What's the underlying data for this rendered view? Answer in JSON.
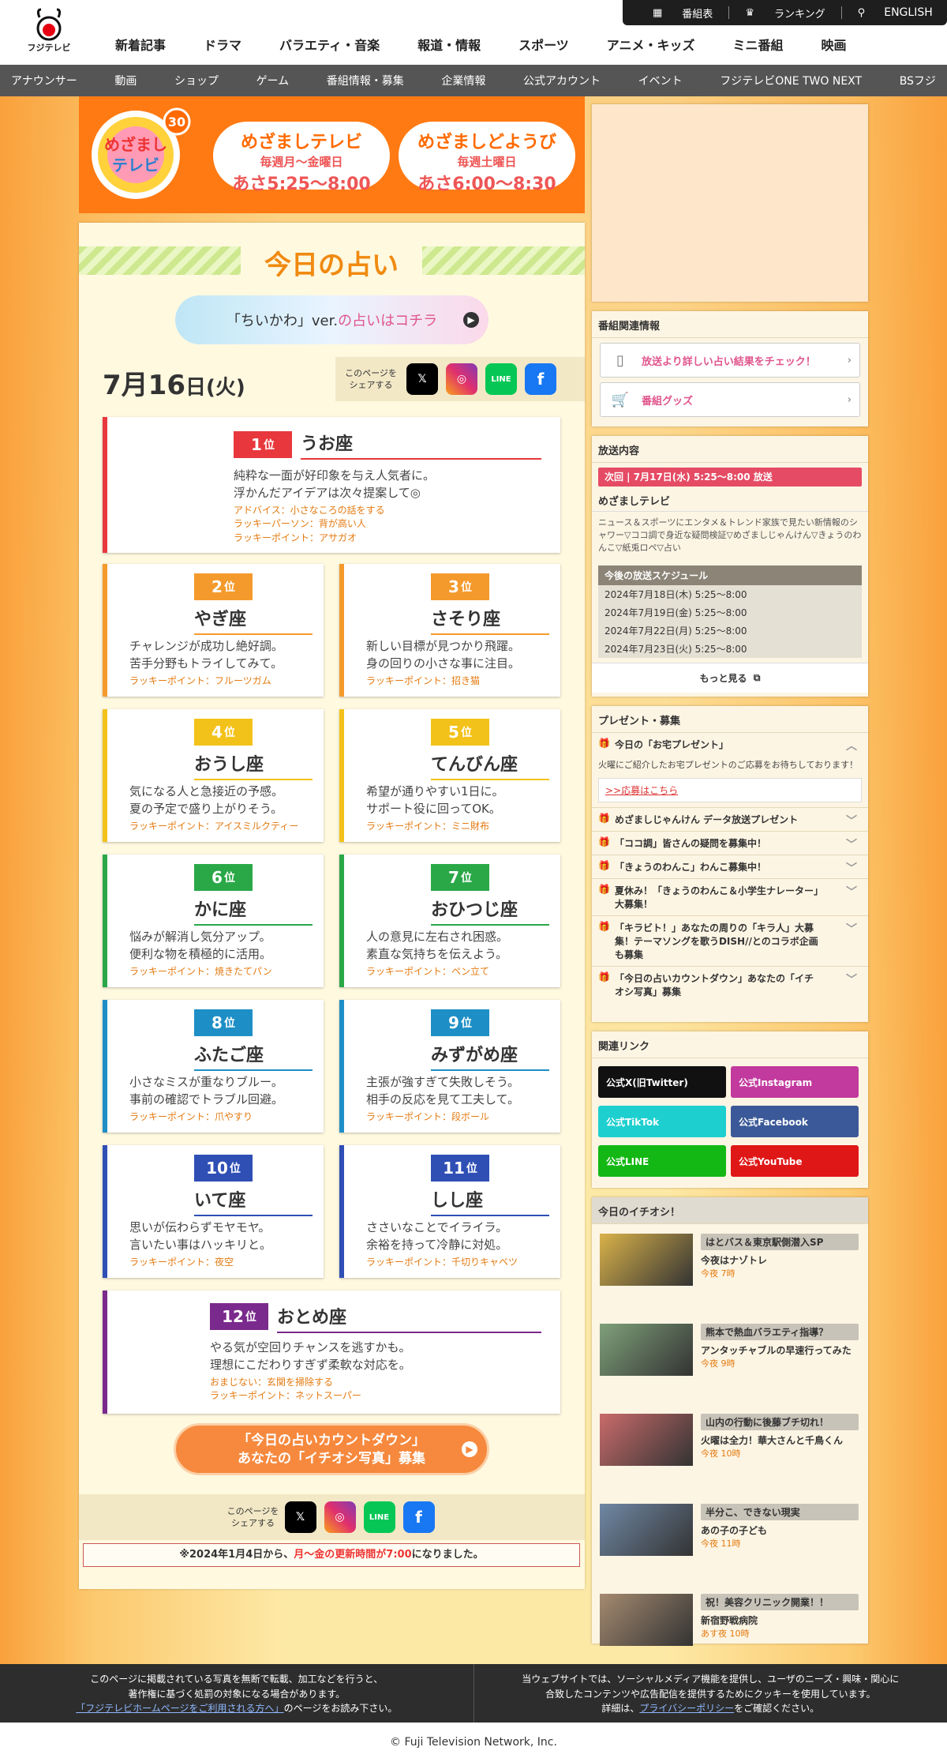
{
  "header": {
    "logo_text": "フジテレビ",
    "util": [
      "番組表",
      "ランキング",
      "検索"
    ],
    "english": "ENGLISH",
    "nav": [
      "新着記事",
      "ドラマ",
      "バラエティ・音楽",
      "報道・情報",
      "スポーツ",
      "アニメ・キッズ",
      "ミニ番組",
      "映画"
    ],
    "subnav": [
      "アナウンサー",
      "動画",
      "ショップ",
      "ゲーム",
      "番組情報・募集",
      "企業情報",
      "公式アカウント",
      "イベント",
      "フジテレビONE TWO NEXT",
      "BSフジ"
    ]
  },
  "banner": {
    "logo": "めざましテレビ 30",
    "p1": {
      "t1": "めざましテレビ",
      "t2": "毎週月〜金曜日",
      "t3": "あさ5:25〜8:00"
    },
    "p2": {
      "t1": "めざましどようび",
      "t2": "毎週土曜日",
      "t3": "あさ6:00〜8:30"
    }
  },
  "uranai": {
    "title": "今日の占い",
    "chiikawa_a": "「ちいかわ」ver.",
    "chiikawa_b": "の占いはコチラ",
    "date_num": "7月16",
    "date_d": "日",
    "date_w": "(火)",
    "share_label": "このページを\nシェアする",
    "cards": [
      {
        "rank": "1",
        "suffix": "位",
        "name": "うお座",
        "l1": "純粋な一面が好印象を与え人気者に。",
        "l2": "浮かんだアイデアは次々提案して◎",
        "x": [
          "アドバイス：小さなころの話をする",
          "ラッキーパーソン：背が高い人",
          "ラッキーポイント：アサガオ"
        ],
        "color": "#e8383d"
      },
      {
        "rank": "2",
        "suffix": "位",
        "name": "やぎ座",
        "l1": "チャレンジが成功し絶好調。",
        "l2": "苦手分野もトライしてみて。",
        "x": [
          "ラッキーポイント：フルーツガム"
        ],
        "color": "#f49a2c"
      },
      {
        "rank": "3",
        "suffix": "位",
        "name": "さそり座",
        "l1": "新しい目標が見つかり飛躍。",
        "l2": "身の回りの小さな事に注目。",
        "x": [
          "ラッキーポイント：招き猫"
        ],
        "color": "#f49a2c"
      },
      {
        "rank": "4",
        "suffix": "位",
        "name": "おうし座",
        "l1": "気になる人と急接近の予感。",
        "l2": "夏の予定で盛り上がりそう。",
        "x": [
          "ラッキーポイント：アイスミルクティー"
        ],
        "color": "#f3c21a"
      },
      {
        "rank": "5",
        "suffix": "位",
        "name": "てんびん座",
        "l1": "希望が通りやすい1日に。",
        "l2": "サポート役に回ってOK。",
        "x": [
          "ラッキーポイント：ミニ財布"
        ],
        "color": "#f3c21a"
      },
      {
        "rank": "6",
        "suffix": "位",
        "name": "かに座",
        "l1": "悩みが解消し気分アップ。",
        "l2": "便利な物を積極的に活用。",
        "x": [
          "ラッキーポイント：焼きたてパン"
        ],
        "color": "#2aa848"
      },
      {
        "rank": "7",
        "suffix": "位",
        "name": "おひつじ座",
        "l1": "人の意見に左右され困惑。",
        "l2": "素直な気持ちを伝えよう。",
        "x": [
          "ラッキーポイント：ペン立て"
        ],
        "color": "#2aa848"
      },
      {
        "rank": "8",
        "suffix": "位",
        "name": "ふたご座",
        "l1": "小さなミスが重なりブルー。",
        "l2": "事前の確認でトラブル回避。",
        "x": [
          "ラッキーポイント：爪やすり"
        ],
        "color": "#1e8fc6"
      },
      {
        "rank": "9",
        "suffix": "位",
        "name": "みずがめ座",
        "l1": "主張が強すぎて失敗しそう。",
        "l2": "相手の反応を見て工夫して。",
        "x": [
          "ラッキーポイント：段ボール"
        ],
        "color": "#1e8fc6"
      },
      {
        "rank": "10",
        "suffix": "位",
        "name": "いて座",
        "l1": "思いが伝わらずモヤモヤ。",
        "l2": "言いたい事はハッキリと。",
        "x": [
          "ラッキーポイント：夜空"
        ],
        "color": "#2f4fb5"
      },
      {
        "rank": "11",
        "suffix": "位",
        "name": "しし座",
        "l1": "ささいなことでイライラ。",
        "l2": "余裕を持って冷静に対処。",
        "x": [
          "ラッキーポイント：千切りキャベツ"
        ],
        "color": "#2f4fb5"
      },
      {
        "rank": "12",
        "suffix": "位",
        "name": "おとめ座",
        "l1": "やる気が空回りチャンスを逃すかも。",
        "l2": "理想にこだわりすぎず柔軟な対応を。",
        "x": [
          "おまじない：玄関を掃除する",
          "ラッキーポイント：ネットスーパー"
        ],
        "color": "#7a2a8c"
      }
    ],
    "countdown_l1": "「今日の占いカウントダウン」",
    "countdown_l2": "あなたの「イチオシ写真」募集",
    "notice_a": "※2024年1月4日から、",
    "notice_b": "月〜金の更新時間が7:00",
    "notice_c": "になりました。"
  },
  "side": {
    "related_head": "番組関連情報",
    "related": [
      "放送より詳しい占い結果をチェック！",
      "番組グッズ"
    ],
    "broadcast_head": "放送内容",
    "next": "次回 | 7月17日(水) 5:25〜8:00 放送",
    "program": "めざましテレビ",
    "desc": "ニュース＆スポーツにエンタメ＆トレンド家族で見たい新情報のシャワー▽ココ調で身近な疑問検証▽めざましじゃんけん▽きょうのわんこ▽紙兎ロペ▽占い",
    "sched_head": "今後の放送スケジュール",
    "sched": [
      "2024年7月18日(木) 5:25〜8:00",
      "2024年7月19日(金) 5:25〜8:00",
      "2024年7月22日(月) 5:25〜8:00",
      "2024年7月23日(火) 5:25〜8:00"
    ],
    "more": "もっと見る",
    "present_head": "プレゼント・募集",
    "present_open": "今日の「お宅プレゼント」",
    "present_desc": "火曜にご紹介したお宅プレゼントのご応募をお待ちしております！",
    "present_link": ">>応募はこちら",
    "present_items": [
      "めざましじゃんけん データ放送プレゼント",
      "「ココ調」皆さんの疑問を募集中！",
      "「きょうのわんこ」わんこ募集中！",
      "夏休み！「きょうのわんこ＆小学生ナレーター」大募集！",
      "「キラビト！」あなたの周りの「キラ人」大募集！テーマソングを歌うDISH//とのコラボ企画も募集",
      "「今日の占いカウントダウン」あなたの「イチオシ写真」募集"
    ],
    "links_head": "関連リンク",
    "links": [
      {
        "label": "公式X(旧Twitter)",
        "color": "#111111"
      },
      {
        "label": "公式Instagram",
        "color": "#c23a9e"
      },
      {
        "label": "公式TikTok",
        "color": "#1ecfcf"
      },
      {
        "label": "公式Facebook",
        "color": "#3b5998"
      },
      {
        "label": "公式LINE",
        "color": "#14b814"
      },
      {
        "label": "公式YouTube",
        "color": "#e01717"
      }
    ],
    "ichi_head": "今日のイチオシ！",
    "ichi": [
      {
        "tag": "はとバス＆東京駅側潜入SP",
        "title": "今夜はナゾトレ",
        "time": "今夜 7時"
      },
      {
        "tag": "熊本で熱血バラエティ指導？",
        "title": "アンタッチャブルの早速行ってみた",
        "time": "今夜 9時"
      },
      {
        "tag": "山内の行動に後藤ブチ切れ！",
        "title": "火曜は全力！華大さんと千鳥くん",
        "time": "今夜 10時"
      },
      {
        "tag": "半分こ、できない現実",
        "title": "あの子の子ども",
        "time": "今夜 11時"
      },
      {
        "tag": "祝！美容クリニック開業！！",
        "title": "新宿野戦病院",
        "time": "あす夜 10時"
      }
    ]
  },
  "footer": {
    "left1": "このページに掲載されている写真を無断で転載、加工などを行うと、",
    "left2": "著作権に基づく処罰の対象になる場合があります。",
    "left3a": "「フジテレビホームページをご利用される方へ」",
    "left3b": "のページをお読み下さい。",
    "right1": "当ウェブサイトでは、ソーシャルメディア機能を提供し、ユーザのニーズ・興味・関心に",
    "right2": "合致したコンテンツや広告配信を提供するためにクッキーを使用しています。",
    "right3a": "詳細は、",
    "right3b": "プライバシーポリシー",
    "right3c": "をご確認ください。",
    "copyright": "© Fuji Television Network, Inc."
  },
  "colors": {
    "accent": "#ff7a13",
    "pink": "#e0558d",
    "red": "#e54b64"
  }
}
